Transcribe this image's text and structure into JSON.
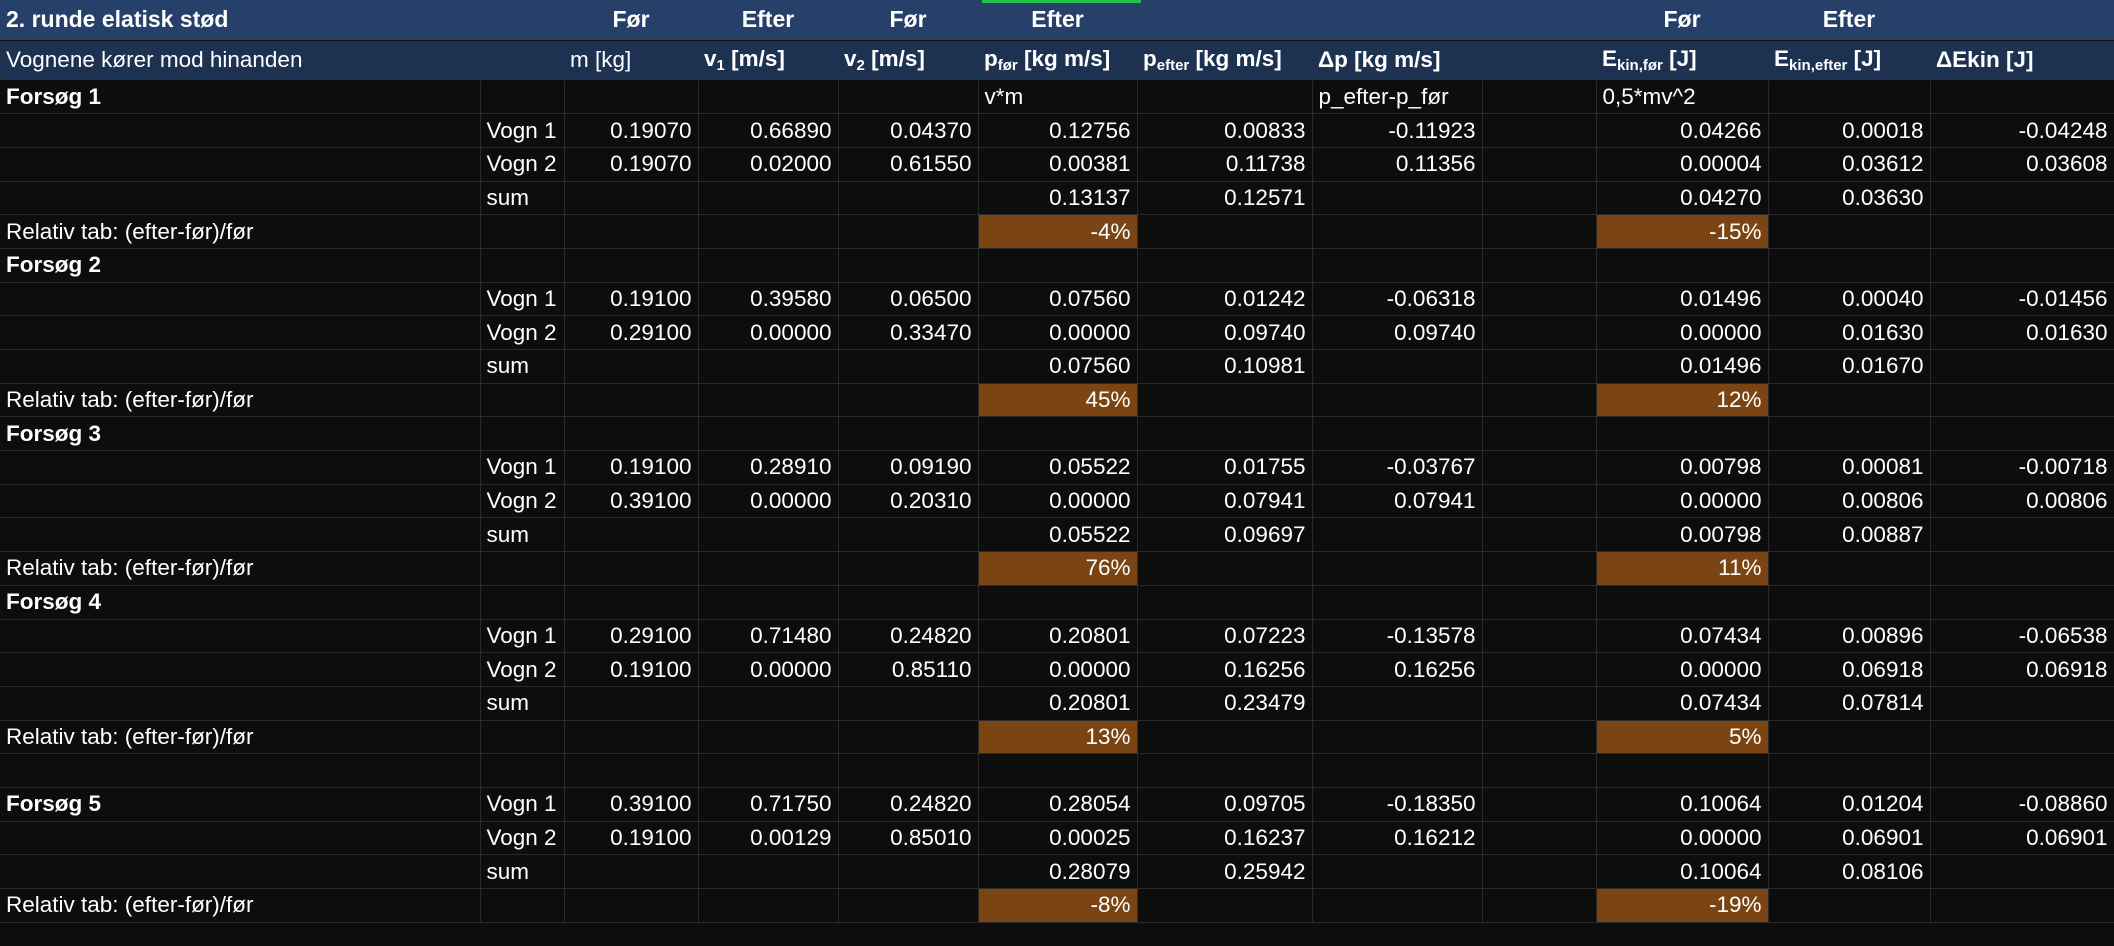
{
  "header_row1": {
    "title": "2. runde elatisk stød",
    "col_v1": "Før",
    "col_v2": "Efter",
    "col_pfor": "Før",
    "col_pefter": "Efter",
    "col_ekinfor": "Før",
    "col_ekinefter": "Efter"
  },
  "header_row2": {
    "desc": "Vognene kører mod hinanden",
    "m": "m [kg]",
    "v1_base": "v",
    "v1_sub": "1",
    "v1_unit": " [m/s]",
    "v2_base": "v",
    "v2_sub": "2",
    "v2_unit": " [m/s]",
    "pfor_base": "p",
    "pfor_sub": "før",
    "pfor_unit": " [kg m/s]",
    "pefter_base": "p",
    "pefter_sub": "efter",
    "pefter_unit": " [kg m/s]",
    "dp": "Δp  [kg m/s]",
    "ekfor_base": "E",
    "ekfor_sub": "kin,før",
    "ekfor_unit": "  [J]",
    "ekefter_base": "E",
    "ekefter_sub": "kin,efter",
    "ekefter_unit": "  [J]",
    "dekin": "ΔEkin [J]"
  },
  "formula_row": {
    "pfor": "v*m",
    "dp": "p_efter-p_før",
    "ekin": "0,5*mv^2"
  },
  "relativ_label": "Relativ tab:  (efter-før)/før",
  "sum_label": "sum",
  "trials": [
    {
      "name": "Forsøg 1",
      "rows": [
        {
          "label": "Vogn 1",
          "m": "0.19070",
          "v1": "0.66890",
          "v2": "0.04370",
          "pfor": "0.12756",
          "pefter": "0.00833",
          "dp": "-0.11923",
          "ekfor": "0.04266",
          "ekefter": "0.00018",
          "dekin": "-0.04248"
        },
        {
          "label": "Vogn 2",
          "m": "0.19070",
          "v1": "0.02000",
          "v2": "0.61550",
          "pfor": "0.00381",
          "pefter": "0.11738",
          "dp": "0.11356",
          "ekfor": "0.00004",
          "ekefter": "0.03612",
          "dekin": "0.03608"
        }
      ],
      "sum": {
        "pfor": "0.13137",
        "pefter": "0.12571",
        "ekfor": "0.04270",
        "ekefter": "0.03630"
      },
      "rel": {
        "p": "-4%",
        "ekin": "-15%"
      }
    },
    {
      "name": "Forsøg 2",
      "rows": [
        {
          "label": "Vogn 1",
          "m": "0.19100",
          "v1": "0.39580",
          "v2": "0.06500",
          "pfor": "0.07560",
          "pefter": "0.01242",
          "dp": "-0.06318",
          "ekfor": "0.01496",
          "ekefter": "0.00040",
          "dekin": "-0.01456"
        },
        {
          "label": "Vogn 2",
          "m": "0.29100",
          "v1": "0.00000",
          "v2": "0.33470",
          "pfor": "0.00000",
          "pefter": "0.09740",
          "dp": "0.09740",
          "ekfor": "0.00000",
          "ekefter": "0.01630",
          "dekin": "0.01630"
        }
      ],
      "sum": {
        "pfor": "0.07560",
        "pefter": "0.10981",
        "ekfor": "0.01496",
        "ekefter": "0.01670"
      },
      "rel": {
        "p": "45%",
        "ekin": "12%"
      }
    },
    {
      "name": "Forsøg 3",
      "rows": [
        {
          "label": "Vogn 1",
          "m": "0.19100",
          "v1": "0.28910",
          "v2": "0.09190",
          "pfor": "0.05522",
          "pefter": "0.01755",
          "dp": "-0.03767",
          "ekfor": "0.00798",
          "ekefter": "0.00081",
          "dekin": "-0.00718"
        },
        {
          "label": "Vogn 2",
          "m": "0.39100",
          "v1": "0.00000",
          "v2": "0.20310",
          "pfor": "0.00000",
          "pefter": "0.07941",
          "dp": "0.07941",
          "ekfor": "0.00000",
          "ekefter": "0.00806",
          "dekin": "0.00806"
        }
      ],
      "sum": {
        "pfor": "0.05522",
        "pefter": "0.09697",
        "ekfor": "0.00798",
        "ekefter": "0.00887"
      },
      "rel": {
        "p": "76%",
        "ekin": "11%"
      }
    },
    {
      "name": "Forsøg 4",
      "rows": [
        {
          "label": "Vogn 1",
          "m": "0.29100",
          "v1": "0.71480",
          "v2": "0.24820",
          "pfor": "0.20801",
          "pefter": "0.07223",
          "dp": "-0.13578",
          "ekfor": "0.07434",
          "ekefter": "0.00896",
          "dekin": "-0.06538"
        },
        {
          "label": "Vogn 2",
          "m": "0.19100",
          "v1": "0.00000",
          "v2": "0.85110",
          "pfor": "0.00000",
          "pefter": "0.16256",
          "dp": "0.16256",
          "ekfor": "0.00000",
          "ekefter": "0.06918",
          "dekin": "0.06918"
        }
      ],
      "sum": {
        "pfor": "0.20801",
        "pefter": "0.23479",
        "ekfor": "0.07434",
        "ekefter": "0.07814"
      },
      "rel": {
        "p": "13%",
        "ekin": "5%"
      }
    },
    {
      "name": "Forsøg 5",
      "rows": [
        {
          "label": "Vogn 1",
          "m": "0.39100",
          "v1": "0.71750",
          "v2": "0.24820",
          "pfor": "0.28054",
          "pefter": "0.09705",
          "dp": "-0.18350",
          "ekfor": "0.10064",
          "ekefter": "0.01204",
          "dekin": "-0.08860"
        },
        {
          "label": "Vogn 2",
          "m": "0.19100",
          "v1": "0.00129",
          "v2": "0.85010",
          "pfor": "0.00025",
          "pefter": "0.16237",
          "dp": "0.16212",
          "ekfor": "0.00000",
          "ekefter": "0.06901",
          "dekin": "0.06901"
        }
      ],
      "sum": {
        "pfor": "0.28079",
        "pefter": "0.25942",
        "ekfor": "0.10064",
        "ekefter": "0.08106"
      },
      "rel": {
        "p": "-8%",
        "ekin": "-19%"
      }
    }
  ],
  "colors": {
    "header_dark": "#27406a",
    "header_light": "#1d3250",
    "highlight": "#7a4512",
    "selection": "#21c04a"
  }
}
